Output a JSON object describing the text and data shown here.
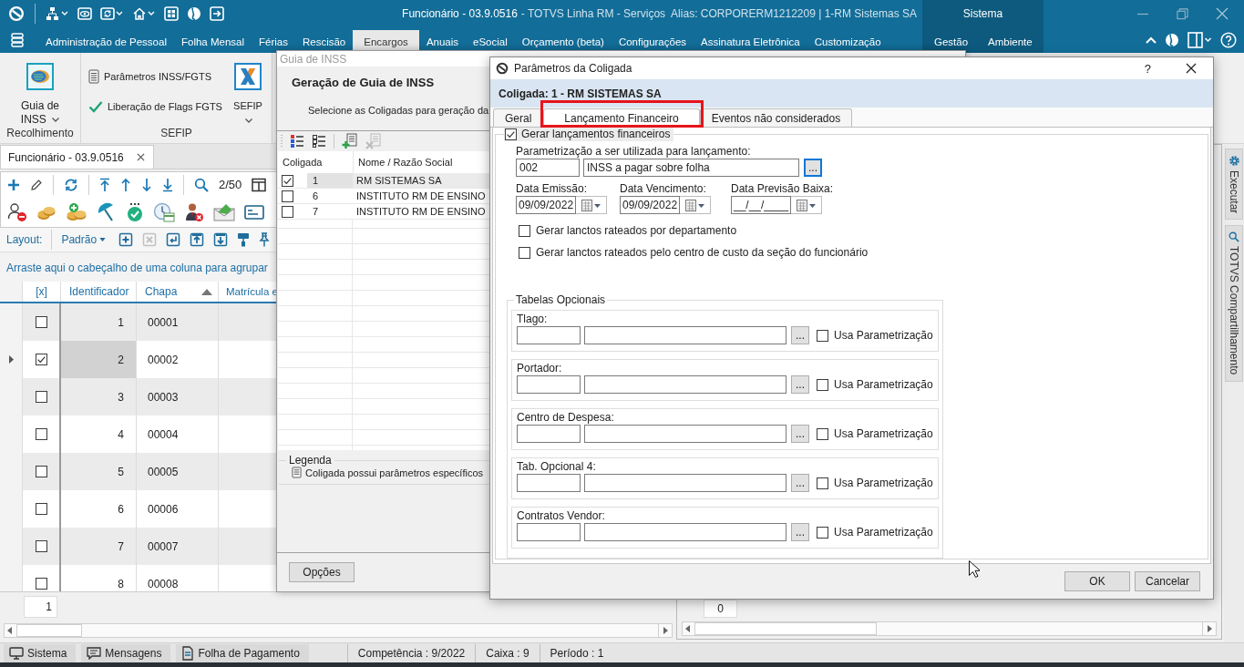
{
  "window": {
    "title": "Funcionário - 03.9.0516",
    "subtitle": "- TOTVS Linha RM - Serviços  Alias: CORPORERM1212209 | 1-RM Sistemas SA"
  },
  "menu": {
    "items": [
      {
        "label": "Administração de Pessoal",
        "selected": false
      },
      {
        "label": "Folha Mensal",
        "selected": false
      },
      {
        "label": "Férias",
        "selected": false
      },
      {
        "label": "Rescisão",
        "selected": false
      },
      {
        "label": "Encargos",
        "selected": true
      },
      {
        "label": "Anuais",
        "selected": false
      },
      {
        "label": "eSocial",
        "selected": false
      },
      {
        "label": "Orçamento (beta)",
        "selected": false
      },
      {
        "label": "Configurações",
        "selected": false
      },
      {
        "label": "Assinatura Eletrônica",
        "selected": false
      },
      {
        "label": "Customização",
        "selected": false
      }
    ],
    "context_group": {
      "label": "Sistema",
      "items": [
        {
          "label": "Gestão",
          "selected": false
        },
        {
          "label": "Ambiente",
          "selected": false
        }
      ]
    }
  },
  "ribbon": {
    "groups": [
      {
        "label": "Recolhimento",
        "items": [
          {
            "kind": "large",
            "label": "Guia de INSS",
            "dropdown": true
          }
        ]
      },
      {
        "label": "SEFIP",
        "items": [
          {
            "kind": "small",
            "label": "Parâmetros INSS/FGTS"
          },
          {
            "kind": "small",
            "label": "Liberação de Flags FGTS"
          },
          {
            "kind": "large",
            "label": "SEFIP",
            "dropdown": true
          }
        ]
      }
    ]
  },
  "document_tab": {
    "label": "Funcionário - 03.9.0516"
  },
  "grid_toolbar": {
    "position": "2/50",
    "layout_label": "Layout:",
    "layout_value": "Padrão",
    "layout_tools": [
      {
        "disabled": false
      },
      {
        "disabled": true
      },
      {
        "disabled": false
      },
      {
        "disabled": false
      },
      {
        "disabled": false
      },
      {
        "disabled": false
      },
      {
        "disabled": false
      }
    ]
  },
  "group_hint": "Arraste aqui o cabeçalho de uma coluna para agrupar",
  "grid": {
    "columns": [
      {
        "label": "[x]"
      },
      {
        "label": "Identificador"
      },
      {
        "label": "Chapa",
        "sorted": true
      },
      {
        "label": "Matrícula e"
      }
    ],
    "rows": [
      {
        "selected": false,
        "checked": false,
        "identificador": "1",
        "chapa": "00001"
      },
      {
        "selected": true,
        "checked": true,
        "identificador": "2",
        "chapa": "00002"
      },
      {
        "selected": false,
        "checked": false,
        "identificador": "3",
        "chapa": "00003"
      },
      {
        "selected": false,
        "checked": false,
        "identificador": "4",
        "chapa": "00004"
      },
      {
        "selected": false,
        "checked": false,
        "identificador": "5",
        "chapa": "00005"
      },
      {
        "selected": false,
        "checked": false,
        "identificador": "6",
        "chapa": "00006"
      },
      {
        "selected": false,
        "checked": false,
        "identificador": "7",
        "chapa": "00007"
      },
      {
        "selected": false,
        "checked": false,
        "identificador": "8",
        "chapa": "00008"
      }
    ],
    "summary": "1"
  },
  "right_panel": {
    "cell": "0"
  },
  "side_tabs": [
    {
      "label": "Executar"
    },
    {
      "label": "TOTVS Compartilhamento"
    }
  ],
  "status_bar": {
    "tabs": [
      {
        "label": "Sistema"
      },
      {
        "label": "Mensagens"
      },
      {
        "label": "Folha de Pagamento"
      }
    ],
    "fields": [
      "Competência : 9/2022",
      "Caixa : 9",
      "Período : 1"
    ]
  },
  "guia_dialog": {
    "title": "Guia de INSS",
    "heading": "Geração de Guia de INSS",
    "instruction": "Selecione as Coligadas para geração da",
    "toolbar": [
      {
        "disabled": false
      },
      {
        "disabled": false
      },
      {
        "disabled": false
      },
      {
        "disabled": true
      }
    ],
    "columns": [
      "Coligada",
      "Nome / Razão Social"
    ],
    "rows": [
      {
        "checked": true,
        "selected": true,
        "code": "1",
        "name": "RM SISTEMAS SA"
      },
      {
        "checked": false,
        "selected": false,
        "code": "6",
        "name": "INSTITUTO RM DE ENSINO"
      },
      {
        "checked": false,
        "selected": false,
        "code": "7",
        "name": "INSTITUTO RM DE ENSINO"
      }
    ],
    "legend": {
      "title": "Legenda",
      "items": [
        "Coligada possui parâmetros específicos"
      ]
    },
    "buttons": [
      "Opções"
    ]
  },
  "params_dialog": {
    "title": "Parâmetros da Coligada",
    "help": "?",
    "header": "Coligada: 1 - RM SISTEMAS SA",
    "tabs": [
      {
        "label": "Geral",
        "selected": false,
        "highlighted": false
      },
      {
        "label": "Lançamento Financeiro",
        "selected": true,
        "highlighted": true
      },
      {
        "label": "Eventos não considerados",
        "selected": false,
        "highlighted": false
      }
    ],
    "generate": {
      "label": "Gerar lançamentos financeiros",
      "checked": true
    },
    "parametrization": {
      "label": "Parametrização a ser utilizada para lançamento:",
      "code": "002",
      "description": "INSS a pagar sobre folha",
      "lookup": "...",
      "focused": true
    },
    "dates": [
      {
        "label": "Data Emissão:",
        "value": "09/09/2022"
      },
      {
        "label": "Data Vencimento:",
        "value": "09/09/2022"
      },
      {
        "label": "Data Previsão Baixa:",
        "value": "__/__/____"
      }
    ],
    "options": [
      {
        "label": "Gerar lanctos rateados por departamento",
        "checked": false
      },
      {
        "label": "Gerar lanctos rateados pelo centro de custo da seção do funcionário",
        "checked": false
      }
    ],
    "optional_tables": {
      "title": "Tabelas Opcionais",
      "items": [
        {
          "label": "Tlago:",
          "lookup": "...",
          "option": "Usa Parametrização",
          "checked": false
        },
        {
          "label": "Portador:",
          "lookup": "...",
          "option": "Usa Parametrização",
          "checked": false
        },
        {
          "label": "Centro de Despesa:",
          "lookup": "...",
          "option": "Usa Parametrização",
          "checked": false
        },
        {
          "label": "Tab. Opcional 4:",
          "lookup": "...",
          "option": "Usa Parametrização",
          "checked": false
        },
        {
          "label": "Contratos Vendor:",
          "lookup": "...",
          "option": "Usa Parametrização",
          "checked": false
        }
      ]
    },
    "buttons": [
      "OK",
      "Cancelar"
    ]
  }
}
